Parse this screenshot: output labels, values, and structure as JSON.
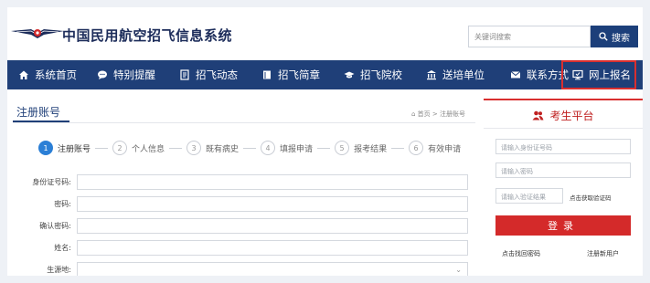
{
  "header": {
    "site_title": "中国民用航空招飞信息系统",
    "search_placeholder": "关键词搜索",
    "search_button": "搜索"
  },
  "nav": {
    "items": [
      {
        "label": "系统首页",
        "icon": "home-icon"
      },
      {
        "label": "特别提醒",
        "icon": "chat-bubble-icon"
      },
      {
        "label": "招飞动态",
        "icon": "document-icon"
      },
      {
        "label": "招飞简章",
        "icon": "book-icon"
      },
      {
        "label": "招飞院校",
        "icon": "graduation-cap-icon"
      },
      {
        "label": "送培单位",
        "icon": "institution-icon"
      },
      {
        "label": "联系方式",
        "icon": "envelope-icon"
      },
      {
        "label": "网上报名",
        "icon": "monitor-icon"
      }
    ],
    "active_index": 7,
    "active_border_color": "#d92f2f"
  },
  "main": {
    "title": "注册账号",
    "breadcrumb": "首页 > 注册账号",
    "steps": [
      {
        "num": "1",
        "label": "注册账号"
      },
      {
        "num": "2",
        "label": "个人信息"
      },
      {
        "num": "3",
        "label": "既有病史"
      },
      {
        "num": "4",
        "label": "填报申请"
      },
      {
        "num": "5",
        "label": "报考结果"
      },
      {
        "num": "6",
        "label": "有效申请"
      }
    ],
    "current_step": 1,
    "form": {
      "id_label": "身份证号码:",
      "password_label": "密码:",
      "confirm_label": "确认密码:",
      "name_label": "姓名:",
      "birthplace_label": "生源地:"
    }
  },
  "sidebar": {
    "title": "考生平台",
    "id_placeholder": "请输入身份证号码",
    "password_placeholder": "请输入密码",
    "captcha_placeholder": "请输入验证结果",
    "captcha_link": "点击获取验证码",
    "login_button": "登录",
    "forgot_link": "点击找回密码",
    "register_link": "注册新用户"
  },
  "colors": {
    "nav_bg": "#1f3f78",
    "accent_red": "#d42a2a",
    "step_active": "#2b7fd6"
  }
}
